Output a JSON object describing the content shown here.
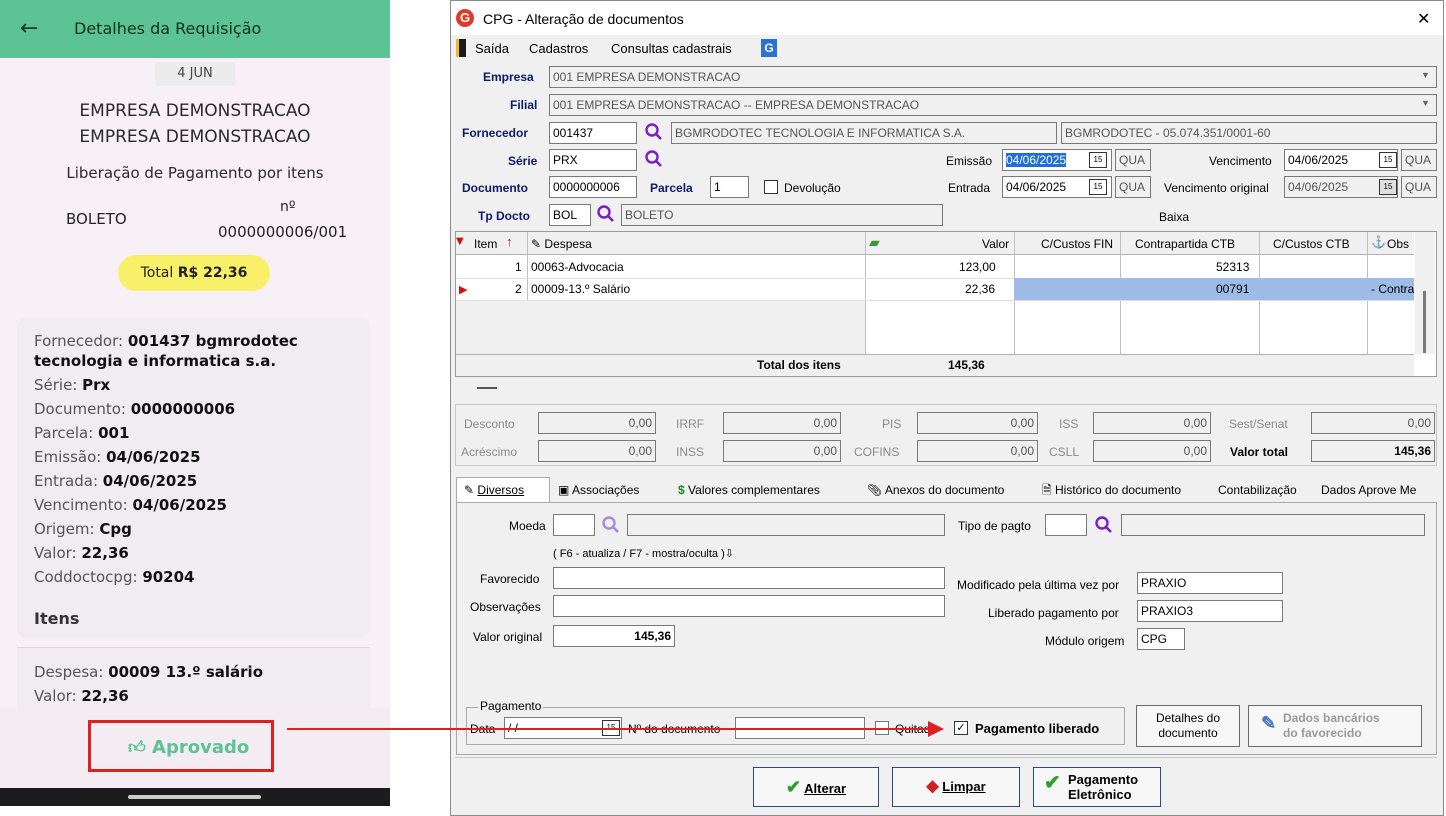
{
  "phone": {
    "header_title": "Detalhes da Requisição",
    "date_badge": "4 JUN",
    "company_line1": "EMPRESA DEMONSTRACAO",
    "company_line2": "EMPRESA DEMONSTRACAO",
    "subtitle": "Liberação de Pagamento por itens",
    "doc_type": "BOLETO",
    "number_label": "nº",
    "number_value": "0000000006/001",
    "total_label": "Total",
    "total_value": "R$ 22,36",
    "details": [
      {
        "label": "Fornecedor:",
        "value": "001437 bgmrodotec"
      },
      {
        "label": "",
        "value": "tecnologia e informatica s.a."
      },
      {
        "label": "Série:",
        "value": "Prx"
      },
      {
        "label": "Documento:",
        "value": "0000000006"
      },
      {
        "label": "Parcela:",
        "value": "001"
      },
      {
        "label": "Emissão:",
        "value": "04/06/2025"
      },
      {
        "label": "Entrada:",
        "value": "04/06/2025"
      },
      {
        "label": "Vencimento:",
        "value": "04/06/2025"
      },
      {
        "label": "Origem:",
        "value": "Cpg"
      },
      {
        "label": "Valor:",
        "value": "22,36"
      },
      {
        "label": "Coddoctocpg:",
        "value": "90204"
      }
    ],
    "itens_title": "Itens",
    "item_despesa_label": "Despesa:",
    "item_despesa_value": "00009 13.º salário",
    "item_valor_label": "Valor:",
    "item_valor_value": "22,36",
    "approved_label": "Aprovado"
  },
  "window": {
    "title": "CPG - Alteração de documentos",
    "close": "✕",
    "menu": [
      "Saída",
      "Cadastros",
      "Consultas cadastrais"
    ],
    "empresa_label": "Empresa",
    "empresa_value": "001 EMPRESA DEMONSTRACAO",
    "filial_label": "Filial",
    "filial_value": "001 EMPRESA DEMONSTRACAO -- EMPRESA DEMONSTRACAO",
    "fornecedor_label": "Fornecedor",
    "fornecedor_code": "001437",
    "fornecedor_name": "BGMRODOTEC TECNOLOGIA E INFORMATICA S.A.",
    "fornecedor_cnpj": "BGMRODOTEC - 05.074.351/0001-60",
    "serie_label": "Série",
    "serie_value": "PRX",
    "emissao_label": "Emissão",
    "emissao_value": "04/06/2025",
    "emissao_day": "QUA",
    "vencimento_label": "Vencimento",
    "vencimento_value": "04/06/2025",
    "vencimento_day": "QUA",
    "documento_label": "Documento",
    "documento_value": "0000000006",
    "parcela_label": "Parcela",
    "parcela_value": "1",
    "devolucao_label": "Devolução",
    "entrada_label": "Entrada",
    "entrada_value": "04/06/2025",
    "entrada_day": "QUA",
    "venc_original_label": "Vencimento original",
    "venc_original_value": "04/06/2025",
    "venc_original_day": "QUA",
    "tpdocto_label": "Tp Docto",
    "tpdocto_code": "BOL",
    "tpdocto_name": "BOLETO",
    "baixa_label": "Baixa",
    "cal_icon": "15",
    "grid": {
      "headers": [
        "Item",
        "Despesa",
        "Valor",
        "C/Custos FIN",
        "Contrapartida CTB",
        "C/Custos CTB",
        "Obs"
      ],
      "rows": [
        {
          "item": "1",
          "despesa": "00063-Advocacia",
          "valor": "123,00",
          "ccfin": "",
          "contrapartida": "52313",
          "ccctb": "",
          "obs": ""
        },
        {
          "item": "2",
          "despesa": "00009-13.º Salário",
          "valor": "22,36",
          "ccfin": "",
          "contrapartida": "00791",
          "ccctb": "",
          "obs": "- Contra"
        }
      ],
      "total_label": "Total dos itens",
      "total_value": "145,36"
    },
    "values": {
      "desconto_label": "Desconto",
      "desconto": "0,00",
      "irrf_label": "IRRF",
      "irrf": "0,00",
      "pis_label": "PIS",
      "pis": "0,00",
      "iss_label": "ISS",
      "iss": "0,00",
      "sest_label": "Sest/Senat",
      "sest": "0,00",
      "acrescimo_label": "Acréscimo",
      "acrescimo": "0,00",
      "inss_label": "INSS",
      "inss": "0,00",
      "cofins_label": "COFINS",
      "cofins": "0,00",
      "csll_label": "CSLL",
      "csll": "0,00",
      "valor_total_label": "Valor total",
      "valor_total": "145,36"
    },
    "tabs": [
      "Diversos",
      "Associações",
      "Valores complementares",
      "Anexos do documento",
      "Histórico do documento",
      "Contabilização",
      "Dados Aprove Me"
    ],
    "diversos": {
      "moeda_label": "Moeda",
      "tipo_pagto_label": "Tipo de pagto",
      "hint": "( F6 - atualiza / F7 - mostra/oculta )",
      "favorecido_label": "Favorecido",
      "observacoes_label": "Observações",
      "valor_original_label": "Valor original",
      "valor_original_value": "145,36",
      "modificado_label": "Modificado pela última vez por",
      "modificado_value": "PRAXIO",
      "liberado_label": "Liberado pagamento por",
      "liberado_value": "PRAXIO3",
      "modulo_label": "Módulo origem",
      "modulo_value": "CPG",
      "pagamento_group": "Pagamento",
      "data_label": "Data",
      "data_value": " /  /",
      "ndoc_label": "Nº do documento",
      "quitado_label": "Quitado",
      "pagamento_liberado_label": "Pagamento liberado",
      "detalhes_btn_line1": "Detalhes do",
      "detalhes_btn_line2": "documento",
      "dados_bancarios_line1": "Dados bancários",
      "dados_bancarios_line2": "do favorecido"
    },
    "buttons": {
      "alterar": "Alterar",
      "limpar": "Limpar",
      "pag_eletronico_line1": "Pagamento",
      "pag_eletronico_line2": "Eletrônico"
    }
  }
}
